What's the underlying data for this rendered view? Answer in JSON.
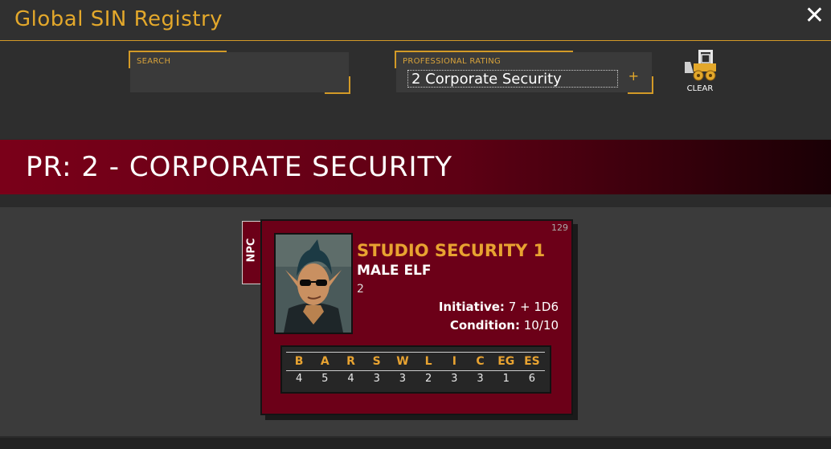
{
  "window": {
    "title": "Global SIN Registry",
    "close_glyph": "✕"
  },
  "filters": {
    "search": {
      "label": "SEARCH",
      "value": ""
    },
    "rating": {
      "label": "PROFESSIONAL RATING",
      "value": "2 Corporate Security",
      "add_glyph": "+"
    },
    "clear": {
      "label": "CLEAR",
      "icon": "bulldozer-icon"
    }
  },
  "banner": {
    "title": "PR: 2 - CORPORATE SECURITY"
  },
  "card": {
    "tag": "NPC",
    "number": "129",
    "name": "STUDIO SECURITY 1",
    "subtitle": "MALE ELF",
    "rating": "2",
    "initiative_label": "Initiative:",
    "initiative_value": "7 + 1D6",
    "condition_label": "Condition:",
    "condition_value": "10/10",
    "attributes": {
      "headers": [
        "B",
        "A",
        "R",
        "S",
        "W",
        "L",
        "I",
        "C",
        "EG",
        "ES"
      ],
      "values": [
        "4",
        "5",
        "4",
        "3",
        "3",
        "2",
        "3",
        "3",
        "1",
        "6"
      ]
    }
  },
  "colors": {
    "accent": "#e3a82b",
    "banner": "#7a0019",
    "card": "#6c0018"
  }
}
